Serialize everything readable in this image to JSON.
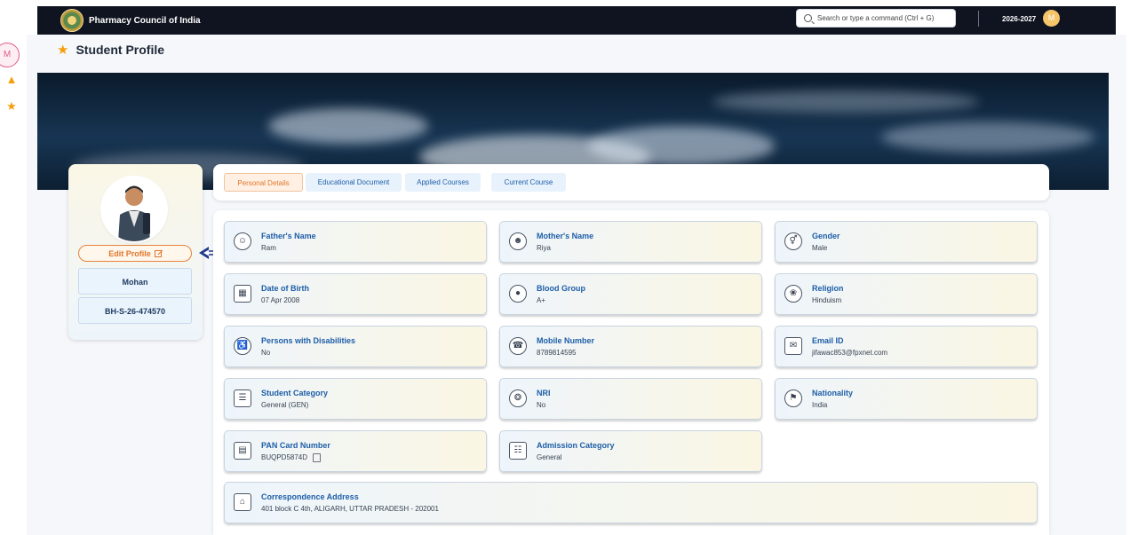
{
  "header": {
    "brand": "Pharmacy Council of India",
    "search_placeholder": "Search or type a command (Ctrl + G)",
    "year": "2026-2027",
    "avatar_letter": "M"
  },
  "rail": {
    "avatar_letter": "M",
    "icons": [
      "home-icon",
      "user-download-icon"
    ]
  },
  "page": {
    "title": "Student Profile"
  },
  "profile": {
    "edit_label": "Edit Profile",
    "name": "Mohan",
    "id": "BH-S-26-474570"
  },
  "tabs": [
    {
      "label": "Personal Details",
      "active": true
    },
    {
      "label": "Educational Document",
      "active": false
    },
    {
      "label": "Applied Courses",
      "active": false
    },
    {
      "label": "Current Course",
      "active": false
    }
  ],
  "fields": [
    {
      "label": "Father's Name",
      "value": "Ram",
      "icon": "person-icon"
    },
    {
      "label": "Mother's Name",
      "value": "Riya",
      "icon": "female-person-icon"
    },
    {
      "label": "Gender",
      "value": "Male",
      "icon": "gender-icon"
    },
    {
      "label": "Date of Birth",
      "value": "07 Apr 2008",
      "icon": "calendar-icon"
    },
    {
      "label": "Blood Group",
      "value": "A+",
      "icon": "blood-drop-icon"
    },
    {
      "label": "Religion",
      "value": "Hinduism",
      "icon": "religion-icon"
    },
    {
      "label": "Persons with Disabilities",
      "value": "No",
      "icon": "wheelchair-icon"
    },
    {
      "label": "Mobile Number",
      "value": "8789814595",
      "icon": "phone-icon"
    },
    {
      "label": "Email ID",
      "value": "jifawac853@fpxnet.com",
      "icon": "email-icon"
    },
    {
      "label": "Student Category",
      "value": "General (GEN)",
      "icon": "category-icon"
    },
    {
      "label": "NRI",
      "value": "No",
      "icon": "globe-icon"
    },
    {
      "label": "Nationality",
      "value": "India",
      "icon": "flag-icon"
    },
    {
      "label": "PAN Card Number",
      "value": "BUQPD5874D",
      "icon": "id-card-icon"
    },
    {
      "label": "Admission Category",
      "value": "General",
      "icon": "admission-icon"
    },
    {
      "label": "Correspondence Address",
      "value": "401 block C 4th, ALIGARH, UTTAR PRADESH - 202001",
      "icon": "address-icon"
    }
  ],
  "colors": {
    "accent_orange": "#e0762a",
    "label_blue": "#1e5ea8",
    "header_dark": "#101420"
  }
}
